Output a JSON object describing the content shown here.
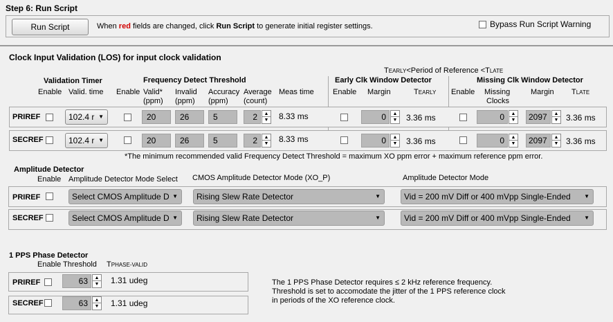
{
  "step6": {
    "title": "Step 6: Run Script",
    "run_button": "Run Script",
    "msg_pre": "When ",
    "msg_red": "red",
    "msg_mid": " fields are changed, click ",
    "msg_bold": "Run Script",
    "msg_post": " to generate initial  register settings.",
    "bypass_label": "Bypass Run Script Warning"
  },
  "los": {
    "title": "Clock Input Validation (LOS) for input clock validation",
    "early_late_hdr_t": "T",
    "early_late_hdr_early": "EARLY",
    "early_late_hdr_mid": "<Period of Reference  <T",
    "early_late_hdr_late": "LATE",
    "validation_timer": "Validation Timer",
    "freq_detect": "Frequency Detect Threshold",
    "early_clk": "Early Clk Window Detector",
    "missing_clk": "Missing Clk Window Detector",
    "col_enable": "Enable",
    "col_valid_time": "Valid. time",
    "col_valid": "Valid*",
    "col_ppm": "(ppm)",
    "col_invalid": "Invalid",
    "col_accuracy": "Accuracy",
    "col_average": "Average",
    "col_count": "(count)",
    "col_meas": "Meas time",
    "col_margin": "Margin",
    "col_t": "T",
    "col_early": "EARLY",
    "col_late": "LATE",
    "col_missing": "Missing",
    "col_clocks": "Clocks",
    "footnote": "*The minimum recommended valid Frequency Detect Threshold = maximum XO ppm error + maximum reference ppm error.",
    "rows": [
      {
        "name": "PRIREF",
        "timer": "102.4 r",
        "valid": "20",
        "invalid": "26",
        "accuracy": "5",
        "average": "2",
        "meas": "8.33 ms",
        "early_margin": "0",
        "t_early": "3.36 ms",
        "missing": "0",
        "late_margin": "2097",
        "t_late": "3.36 ms"
      },
      {
        "name": "SECREF",
        "timer": "102.4 r",
        "valid": "20",
        "invalid": "26",
        "accuracy": "5",
        "average": "2",
        "meas": "8.33 ms",
        "early_margin": "0",
        "t_early": "3.36 ms",
        "missing": "0",
        "late_margin": "2097",
        "t_late": "3.36 ms"
      }
    ]
  },
  "amp": {
    "title": "Amplitude Detector",
    "col_enable": "Enable",
    "col_mode_select": "Amplitude Detector Mode Select",
    "col_cmos": "CMOS Amplitude Detector Mode (XO_P)",
    "col_amp_mode": "Amplitude Detector Mode",
    "rows": [
      {
        "name": "PRIREF",
        "mode_select": "Select CMOS Amplitude D",
        "cmos": "Rising Slew Rate Detector",
        "amp_mode": "Vid = 200 mV Diff or 400 mVpp Single-Ended"
      },
      {
        "name": "SECREF",
        "mode_select": "Select CMOS Amplitude D",
        "cmos": "Rising Slew Rate Detector",
        "amp_mode": "Vid = 200 mV Diff or 400 mVpp Single-Ended"
      }
    ]
  },
  "pps": {
    "title": "1 PPS Phase Detector",
    "col_enable": "Enable",
    "col_threshold": "Threshold",
    "col_t": "T",
    "col_phase_valid": "PHASE-VALID",
    "rows": [
      {
        "name": "PRIREF",
        "threshold": "63",
        "value": "1.31 udeg"
      },
      {
        "name": "SECREF",
        "threshold": "63",
        "value": "1.31 udeg"
      }
    ],
    "note1": "The 1 PPS Phase Detector requires ≤ 2 kHz reference frequency.",
    "note2": "Threshold is set to accomodate the jitter of the 1 PPS reference clock",
    "note3": "in periods of the XO reference clock."
  }
}
